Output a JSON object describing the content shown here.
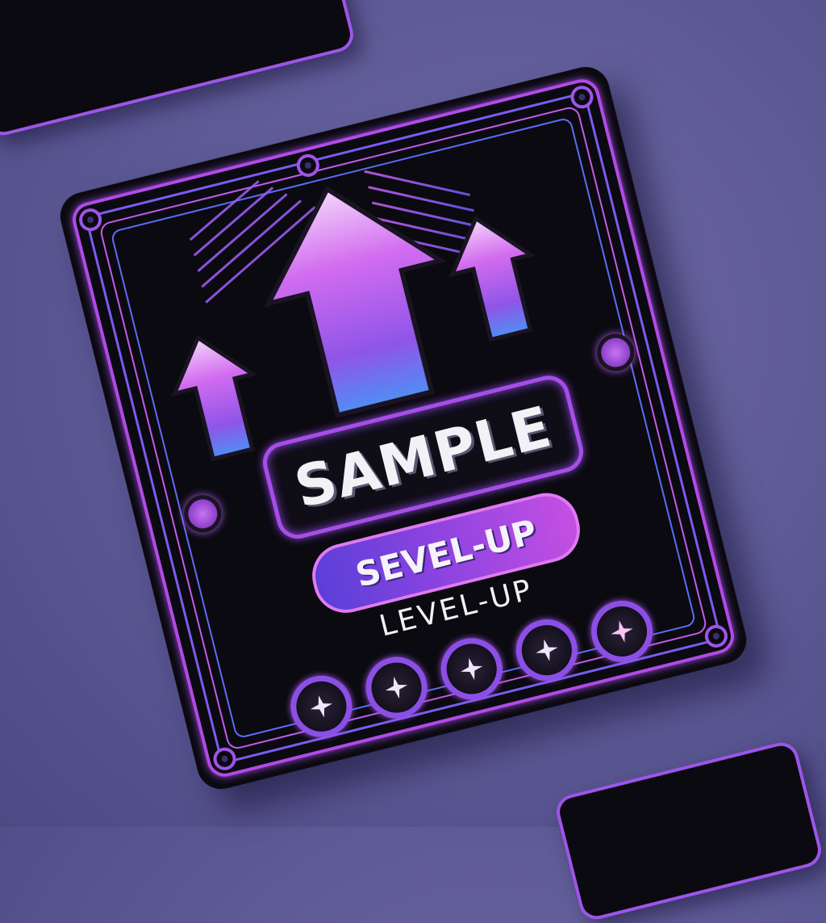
{
  "card": {
    "title": "SAMPLE",
    "pill_label": "SEVEL-UP",
    "subtitle": "LEVEL-UP",
    "star_slots": [
      {
        "icon": "sparkle-icon"
      },
      {
        "icon": "sparkle-icon"
      },
      {
        "icon": "sparkle-icon"
      },
      {
        "icon": "sparkle-icon"
      },
      {
        "icon": "sparkle-icon"
      }
    ],
    "arrows": [
      "up-arrow-icon",
      "up-arrow-icon",
      "up-arrow-icon"
    ]
  },
  "colors": {
    "background": "#5c5894",
    "card_base": "#0b0a10",
    "neon_purple": "#a74ee6",
    "neon_violet": "#7a5cf0",
    "neon_pink": "#e07af4",
    "neon_blue": "#5c6cf4",
    "text": "#f2f2f6"
  }
}
